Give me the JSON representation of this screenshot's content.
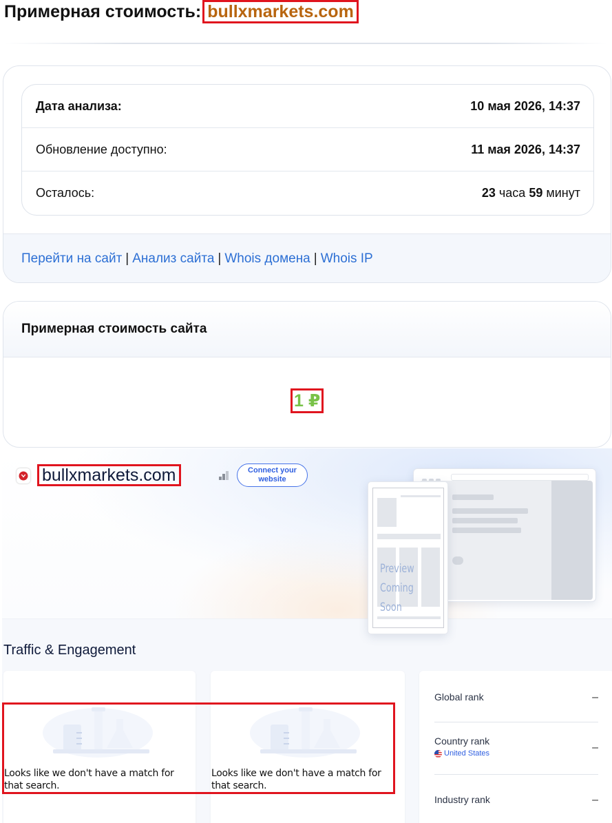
{
  "header": {
    "title_prefix": "Примерная стоимость:",
    "domain": "bullxmarkets.com"
  },
  "analysis": {
    "rows": [
      {
        "label": "Дата анализа:",
        "value": "10 мая 2026, 14:37"
      },
      {
        "label": "Обновление доступно:",
        "value": "11 мая 2026, 14:37"
      },
      {
        "label": "Осталось:",
        "hours": "23",
        "hours_unit": "часа",
        "minutes": "59",
        "minutes_unit": "минут"
      }
    ]
  },
  "links": {
    "goto_site": "Перейти на сайт",
    "site_analysis": "Анализ сайта",
    "whois_domain": "Whois домена",
    "whois_ip": "Whois IP",
    "separator": "|"
  },
  "valuation": {
    "heading": "Примерная стоимость сайта",
    "price": "1 ₽"
  },
  "embed": {
    "site_name": "bullxmarkets.com",
    "connect_button": "Connect your website",
    "preview_line1": "Preview",
    "preview_line2": "Coming Soon",
    "traffic_title": "Traffic & Engagement",
    "no_match_text": "Looks like we don't have a match for that search.",
    "ranks": {
      "global_label": "Global rank",
      "global_value": "–",
      "country_label": "Country rank",
      "country_name": "United States",
      "country_value": "–",
      "industry_label": "Industry rank",
      "industry_value": "–"
    }
  },
  "colors": {
    "domain_accent": "#b8650f",
    "price_green": "#78c248",
    "link_blue": "#2c6fd4",
    "highlight_red": "#e0141e"
  }
}
